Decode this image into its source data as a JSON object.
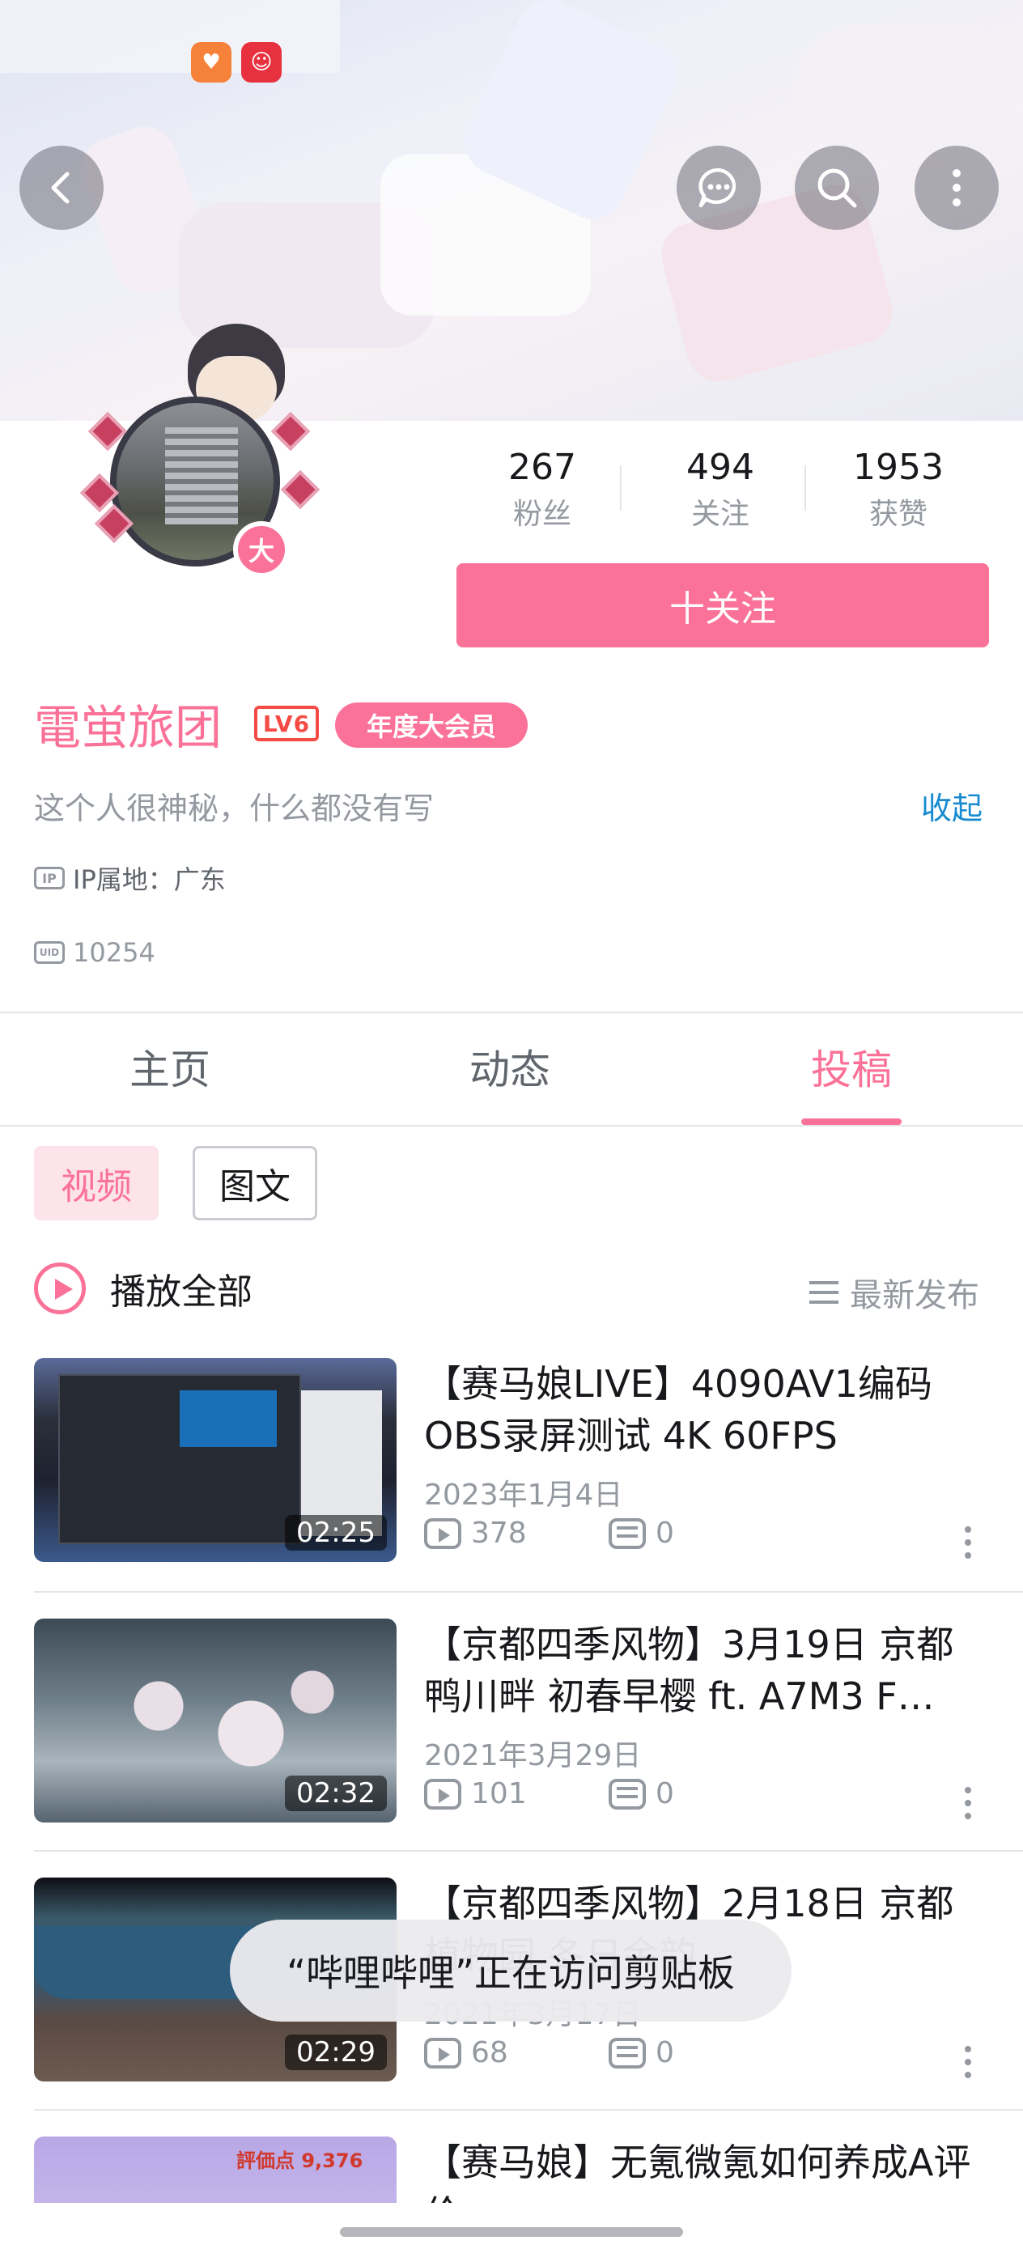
{
  "profile": {
    "stats": [
      {
        "value": "267",
        "label": "粉丝"
      },
      {
        "value": "494",
        "label": "关注"
      },
      {
        "value": "1953",
        "label": "获赞"
      }
    ],
    "follow_button": "十关注",
    "name": "電蛍旅团",
    "level_badge": "LV6",
    "vip_badge": "年度大会员",
    "avatar_badge": "大",
    "bio": "这个人很神秘，什么都没有写",
    "collapse_link": "收起",
    "ip_icon": "IP",
    "ip_location": "IP属地：广东",
    "uid_icon": "UID",
    "uid": "10254"
  },
  "tabs": [
    {
      "label": "主页",
      "active": false
    },
    {
      "label": "动态",
      "active": false
    },
    {
      "label": "投稿",
      "active": true
    }
  ],
  "filters": {
    "video": "视频",
    "article": "图文"
  },
  "list": {
    "play_all": "播放全部",
    "sort": "最新发布",
    "videos": [
      {
        "title": "【赛马娘LIVE】4090AV1编码OBS录屏测试 4K 60FPS",
        "date": "2023年1月4日",
        "views": "378",
        "danmaku": "0",
        "duration": "02:25"
      },
      {
        "title": "【京都四季风物】3月19日 京都 鸭川畔 初春早樱 ft. A7M3 F…",
        "date": "2021年3月29日",
        "views": "101",
        "danmaku": "0",
        "duration": "02:32"
      },
      {
        "title": "【京都四季风物】2月18日 京都 植物园 冬日余韵",
        "date": "2021年3月17日",
        "views": "68",
        "danmaku": "0",
        "duration": "02:29"
      },
      {
        "title": "【赛马娘】无氪微氪如何养成A评价",
        "date": "",
        "views": "",
        "danmaku": "",
        "duration": ""
      }
    ],
    "thumb4_label": "評価点 9,376"
  },
  "toast": "“哔哩哔哩”正在访问剪贴板",
  "icons": {
    "back": "back-arrow-icon",
    "message": "message-icon",
    "search": "search-icon",
    "more": "more-vertical-icon"
  },
  "colors": {
    "accent": "#fb7299",
    "link": "#178bcf",
    "muted": "#9499a0"
  }
}
